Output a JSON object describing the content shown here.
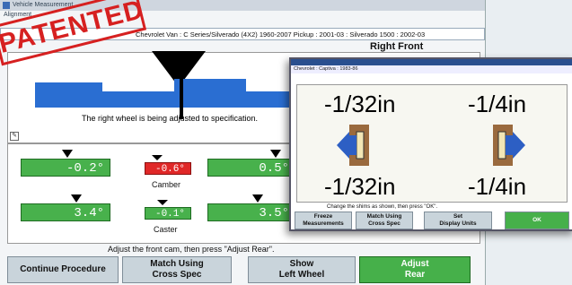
{
  "window": {
    "title": "Vehicle Measurement",
    "menu": "Alignment"
  },
  "vehicle": {
    "description": "Chevrolet Van : C Series/Silverado (4X2) 1960-2007 Pickup : 2001-03 : Silverado 1500 : 2002-03"
  },
  "stamp": {
    "text": "PATENTED"
  },
  "toe": {
    "side_label": "Right Front",
    "message": "The right wheel is being adjusted to specification."
  },
  "readings": {
    "camber_left": "-0.2°",
    "camber_center": "-0.6°",
    "camber_right": "0.5°",
    "camber_label": "Camber",
    "caster_left": "3.4°",
    "caster_center": "-0.1°",
    "caster_right": "3.5°",
    "caster_label": "Caster"
  },
  "status": {
    "message": "Adjust the front cam, then press \"Adjust Rear\"."
  },
  "buttons": {
    "continue": "Continue Procedure",
    "match": "Match Using\nCross Spec",
    "show_left": "Show\nLeft Wheel",
    "adjust_rear": "Adjust\nRear"
  },
  "popup": {
    "vehicle": "Chevrolet : Captiva : 1983-86",
    "top_left": "-1/32in",
    "top_right": "-1/4in",
    "bottom_left": "-1/32in",
    "bottom_right": "-1/4in",
    "instruction": "Change the shims as shown, then press \"OK\".",
    "btn_freeze": "Freeze\nMeasurements",
    "btn_match": "Match Using\nCross Spec",
    "btn_units": "Set\nDisplay Units",
    "btn_ok": "OK"
  },
  "colors": {
    "gauge_green": "#48b14c",
    "gauge_red": "#e02828",
    "bar_blue": "#2a6ed2",
    "button_green": "#46b04a"
  }
}
